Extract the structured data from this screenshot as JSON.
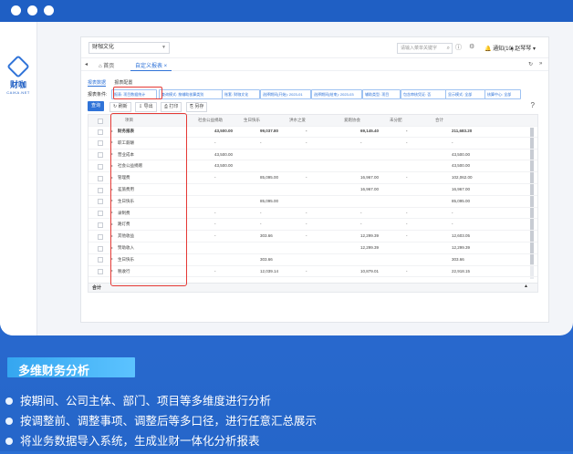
{
  "app": {
    "brand": "财咖",
    "brand_sub": "CAIKA.NET",
    "company": "财咖文化",
    "search_placeholder": "请输入菜单关键字",
    "notice": "通知(10)",
    "user": "赵琴琴"
  },
  "tabs": {
    "home": "首页",
    "current": "自定义报表 ×"
  },
  "subtabs": [
    "报表数据",
    "报表配置"
  ],
  "filters": {
    "label": "报表条件:",
    "chips": [
      "报表: 项目数据统计",
      "查询模式: 按辅助核算类别",
      "账套: 财咖文化",
      "选择期间(开始): 2023-01",
      "选择期间(结束): 2023-03",
      "辅助类型: 项目",
      "包含审核凭证: 否",
      "显示模式: 全部",
      "核算中心: 全部"
    ]
  },
  "actions": {
    "query": "查询",
    "refresh": "刷新",
    "export": "导出",
    "print": "打印",
    "save": "另存"
  },
  "table": {
    "headers": [
      "项目",
      "社会公益捐助",
      "生日快乐",
      "洪水之爱",
      "爱跑协会",
      "未分配",
      "合计"
    ],
    "rows": [
      {
        "name": "财务报表",
        "bold": true,
        "vals": [
          "43,500.00",
          "99,037.80",
          "-",
          "69,145.40",
          "-",
          "211,683.20"
        ]
      },
      {
        "name": "职工薪酬",
        "bold": false,
        "vals": [
          "-",
          "-",
          "-",
          "-",
          "-",
          "-"
        ]
      },
      {
        "name": "营业成本",
        "bold": false,
        "vals": [
          "43,500.00",
          "",
          "",
          "",
          "",
          "43,500.00"
        ]
      },
      {
        "name": "社会公益捐赠",
        "bold": false,
        "vals": [
          "43,500.00",
          "",
          "",
          "",
          "",
          "43,500.00"
        ]
      },
      {
        "name": "管理费",
        "bold": false,
        "vals": [
          "-",
          "85,095.00",
          "-",
          "16,967.00",
          "-",
          "102,062.00"
        ]
      },
      {
        "name": "差旅费用",
        "bold": false,
        "vals": [
          "",
          "",
          "",
          "16,967.00",
          "",
          "16,967.00"
        ]
      },
      {
        "name": "生日快乐",
        "bold": false,
        "vals": [
          "",
          "85,095.00",
          "",
          "",
          "",
          "85,095.00"
        ]
      },
      {
        "name": "录制费",
        "bold": false,
        "vals": [
          "-",
          "-",
          "-",
          "-",
          "-",
          "-"
        ]
      },
      {
        "name": "路灯费",
        "bold": false,
        "vals": [
          "-",
          "-",
          "-",
          "-",
          "-",
          "-"
        ]
      },
      {
        "name": "其他收益",
        "bold": false,
        "vals": [
          "-",
          "303.66",
          "-",
          "12,299.39",
          "-",
          "12,603.05"
        ]
      },
      {
        "name": "赞助收入",
        "bold": false,
        "vals": [
          "",
          "",
          "",
          "12,299.39",
          "",
          "12,299.39"
        ]
      },
      {
        "name": "生日快乐",
        "bold": false,
        "vals": [
          "",
          "303.66",
          "",
          "",
          "",
          "303.66"
        ]
      },
      {
        "name": "税收行",
        "bold": false,
        "vals": [
          "-",
          "12,039.14",
          "-",
          "10,879.01",
          "-",
          "22,918.15"
        ]
      }
    ],
    "footer": "合计"
  },
  "feature": {
    "title": "多维财务分析",
    "bullets": [
      "按期间、公司主体、部门、项目等多维度进行分析",
      "按调整前、调整事项、调整后等多口径，进行任意汇总展示",
      "将业务数据导入系统，生成业财一体化分析报表"
    ]
  },
  "colors": {
    "accent": "#2f73d8",
    "highlight": "#e53935",
    "banner": "#3aa9f2"
  }
}
